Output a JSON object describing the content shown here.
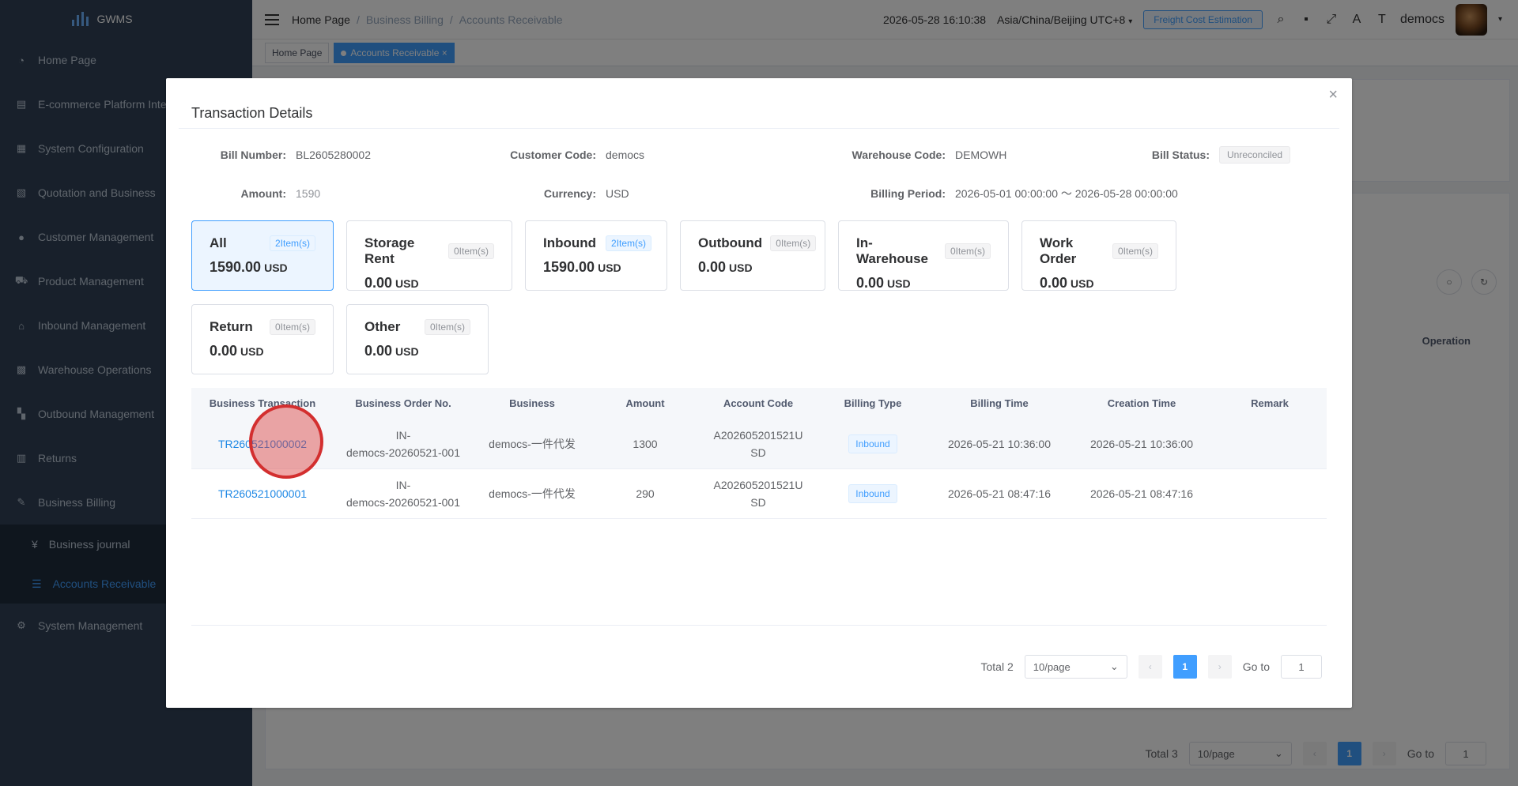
{
  "app": {
    "logo_text": "GWMS"
  },
  "sidebar": {
    "items": [
      {
        "label": "Home Page",
        "icon": "dashboard-icon"
      },
      {
        "label": "E-commerce Platform Inte",
        "icon": "store-icon"
      },
      {
        "label": "System Configuration",
        "icon": "config-icon"
      },
      {
        "label": "Quotation and Business",
        "icon": "quote-icon"
      },
      {
        "label": "Customer Management",
        "icon": "user-icon"
      },
      {
        "label": "Product Management",
        "icon": "cart-icon"
      },
      {
        "label": "Inbound Management",
        "icon": "home-icon"
      },
      {
        "label": "Warehouse Operations",
        "icon": "grid-icon"
      },
      {
        "label": "Outbound Management",
        "icon": "apps-icon"
      },
      {
        "label": "Returns",
        "icon": "doc-icon"
      },
      {
        "label": "Business Billing",
        "icon": "edit-icon"
      }
    ],
    "subitems": [
      {
        "label": "Business journal",
        "icon": "yen-icon"
      },
      {
        "label": "Accounts Receivable",
        "icon": "list-icon"
      }
    ],
    "last_item": {
      "label": "System Management",
      "icon": "gear-icon"
    }
  },
  "header": {
    "breadcrumb": [
      "Home Page",
      "Business Billing",
      "Accounts Receivable"
    ],
    "datetime": "2026-05-28 16:10:38",
    "timezone": "Asia/China/Beijing UTC+8",
    "freight_button": "Freight Cost Estimation",
    "username": "democs"
  },
  "tags": [
    {
      "label": "Home Page"
    },
    {
      "label": "Accounts Receivable"
    }
  ],
  "background": {
    "operation_header": "Operation",
    "pager": {
      "total": "Total 3",
      "per_page": "10/page",
      "page": "1",
      "goto_label": "Go to",
      "goto_value": "1"
    }
  },
  "dialog": {
    "title": "Transaction Details",
    "info": {
      "bill_number_label": "Bill Number:",
      "bill_number": "BL2605280002",
      "customer_code_label": "Customer Code:",
      "customer_code": "democs",
      "warehouse_code_label": "Warehouse Code:",
      "warehouse_code": "DEMOWH",
      "bill_status_label": "Bill Status:",
      "bill_status": "Unreconciled",
      "amount_label": "Amount:",
      "amount": "1590",
      "currency_label": "Currency:",
      "currency": "USD",
      "billing_period_label": "Billing Period:",
      "billing_period": "2026-05-01 00:00:00 ～ 2026-05-28 00:00:00"
    },
    "cards": [
      {
        "name": "All",
        "count": "2Item(s)",
        "amount": "1590.00",
        "currency": "USD"
      },
      {
        "name": "Storage Rent",
        "count": "0Item(s)",
        "amount": "0.00",
        "currency": "USD"
      },
      {
        "name": "Inbound",
        "count": "2Item(s)",
        "amount": "1590.00",
        "currency": "USD"
      },
      {
        "name": "Outbound",
        "count": "0Item(s)",
        "amount": "0.00",
        "currency": "USD"
      },
      {
        "name": "In-Warehouse",
        "count": "0Item(s)",
        "amount": "0.00",
        "currency": "USD"
      },
      {
        "name": "Work Order",
        "count": "0Item(s)",
        "amount": "0.00",
        "currency": "USD"
      },
      {
        "name": "Return",
        "count": "0Item(s)",
        "amount": "0.00",
        "currency": "USD"
      },
      {
        "name": "Other",
        "count": "0Item(s)",
        "amount": "0.00",
        "currency": "USD"
      }
    ],
    "table": {
      "columns": [
        "Business Transaction",
        "Business Order No.",
        "Business",
        "Amount",
        "Account Code",
        "Billing Type",
        "Billing Time",
        "Creation Time",
        "Remark"
      ],
      "rows": [
        {
          "transaction": "TR260521000002",
          "order_no_1": "IN-",
          "order_no_2": "democs-20260521-001",
          "business": "democs-一件代发",
          "amount": "1300",
          "account_1": "A202605201521U",
          "account_2": "SD",
          "billing_type": "Inbound",
          "billing_time": "2026-05-21 10:36:00",
          "creation_time": "2026-05-21 10:36:00",
          "remark": ""
        },
        {
          "transaction": "TR260521000001",
          "order_no_1": "IN-",
          "order_no_2": "democs-20260521-001",
          "business": "democs-一件代发",
          "amount": "290",
          "account_1": "A202605201521U",
          "account_2": "SD",
          "billing_type": "Inbound",
          "billing_time": "2026-05-21 08:47:16",
          "creation_time": "2026-05-21 08:47:16",
          "remark": ""
        }
      ]
    },
    "pager": {
      "total": "Total 2",
      "per_page": "10/page",
      "page": "1",
      "goto_label": "Go to",
      "goto_value": "1"
    }
  },
  "colors": {
    "sidebar_bg": "#304156",
    "accent": "#409eff",
    "link": "#1e88e5"
  }
}
